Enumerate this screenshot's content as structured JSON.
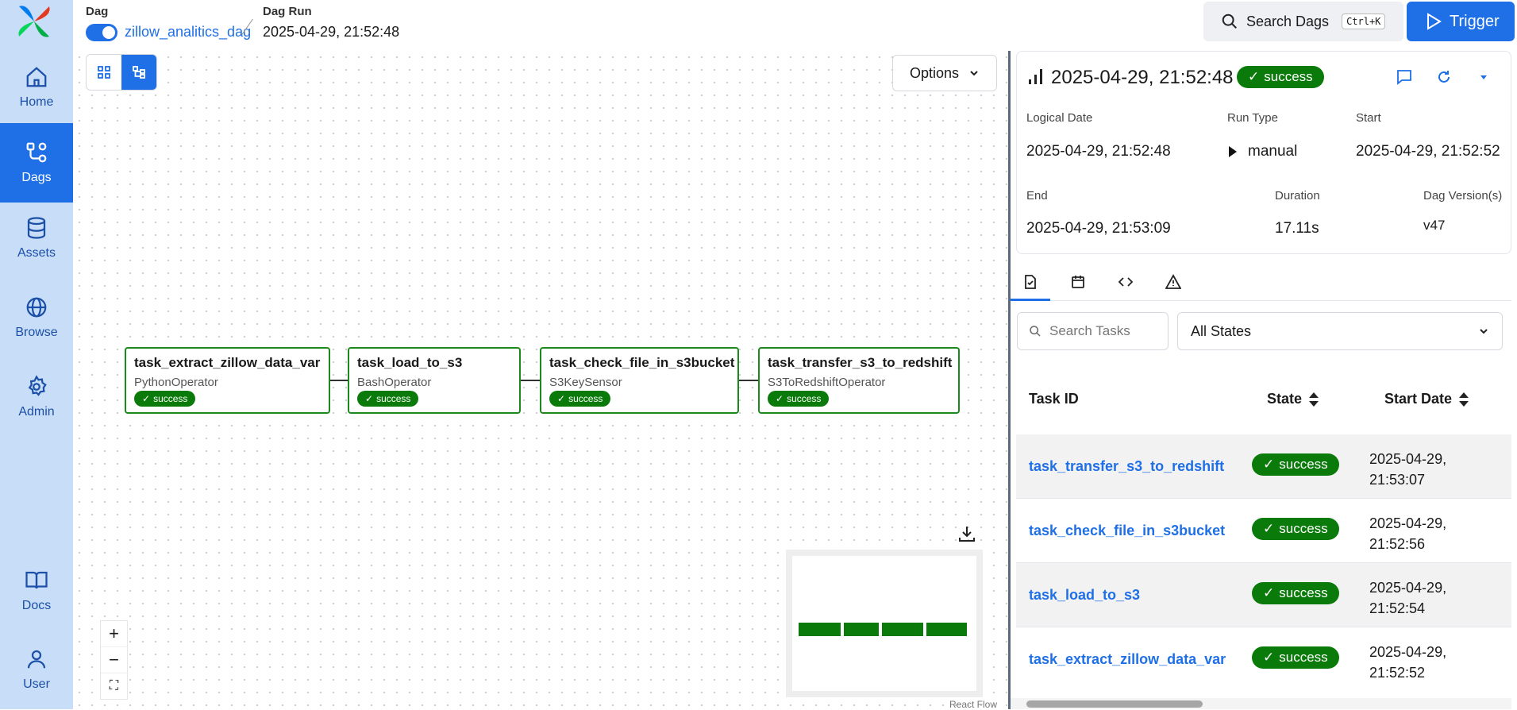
{
  "sidebar": {
    "items": [
      {
        "label": "Home",
        "icon": "home-icon"
      },
      {
        "label": "Dags",
        "icon": "dag-icon",
        "active": true
      },
      {
        "label": "Assets",
        "icon": "database-icon"
      },
      {
        "label": "Browse",
        "icon": "globe-icon"
      },
      {
        "label": "Admin",
        "icon": "gear-icon"
      },
      {
        "label": "Docs",
        "icon": "book-icon"
      },
      {
        "label": "User",
        "icon": "user-icon"
      }
    ]
  },
  "breadcrumb": {
    "dag_label": "Dag",
    "dag_name": "zillow_analitics_dag",
    "run_label": "Dag Run",
    "run_value": "2025-04-29, 21:52:48"
  },
  "header": {
    "search_label": "Search Dags",
    "search_shortcut": "Ctrl+K",
    "trigger_label": "Trigger"
  },
  "graph": {
    "options_label": "Options",
    "nodes": [
      {
        "name": "task_extract_zillow_data_var",
        "operator": "PythonOperator",
        "state": "success"
      },
      {
        "name": "task_load_to_s3",
        "operator": "BashOperator",
        "state": "success"
      },
      {
        "name": "task_check_file_in_s3bucket",
        "operator": "S3KeySensor",
        "state": "success"
      },
      {
        "name": "task_transfer_s3_to_redshift",
        "operator": "S3ToRedshiftOperator",
        "state": "success"
      }
    ],
    "zoom_in": "+",
    "zoom_out": "−",
    "fit": "⛶",
    "react_flow": "React Flow"
  },
  "run_details": {
    "title": "2025-04-29, 21:52:48",
    "state": "success",
    "logical_date_label": "Logical Date",
    "logical_date": "2025-04-29, 21:52:48",
    "run_type_label": "Run Type",
    "run_type": "manual",
    "start_label": "Start",
    "start": "2025-04-29, 21:52:52",
    "end_label": "End",
    "end": "2025-04-29, 21:53:09",
    "duration_label": "Duration",
    "duration": "17.11s",
    "version_label": "Dag Version(s)",
    "version": "v47"
  },
  "tasks_table": {
    "search_placeholder": "Search Tasks",
    "state_filter": "All States",
    "headers": {
      "task_id": "Task ID",
      "state": "State",
      "start_date": "Start Date"
    },
    "rows": [
      {
        "task_id": "task_transfer_s3_to_redshift",
        "state": "success",
        "date_line1": "2025-04-29,",
        "date_line2": "21:53:07"
      },
      {
        "task_id": "task_check_file_in_s3bucket",
        "state": "success",
        "date_line1": "2025-04-29,",
        "date_line2": "21:52:56"
      },
      {
        "task_id": "task_load_to_s3",
        "state": "success",
        "date_line1": "2025-04-29,",
        "date_line2": "21:52:54"
      },
      {
        "task_id": "task_extract_zillow_data_var",
        "state": "success",
        "date_line1": "2025-04-29,",
        "date_line2": "21:52:52"
      }
    ]
  },
  "colors": {
    "accent": "#1f6fe6",
    "success": "#0a7a0a",
    "sidebar": "#c8def8"
  }
}
